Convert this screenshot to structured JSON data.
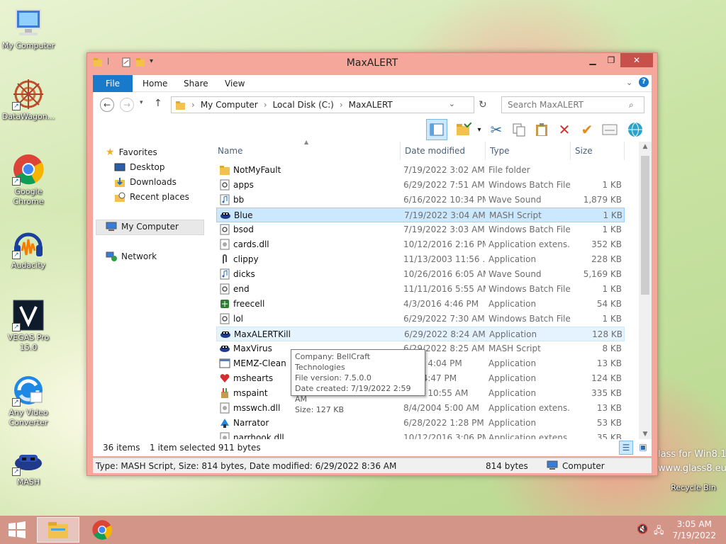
{
  "desktop": {
    "icons": [
      {
        "label": "My Computer",
        "icon": "computer-icon"
      },
      {
        "label": "DataWagon...",
        "icon": "datawagon-icon"
      },
      {
        "label": "Google Chrome",
        "icon": "chrome-icon"
      },
      {
        "label": "Audacity",
        "icon": "audacity-icon"
      },
      {
        "label": "VEGAS Pro 15.0",
        "icon": "vegas-icon"
      },
      {
        "label": "Any Video Converter",
        "icon": "video-converter-icon"
      },
      {
        "label": "MASH",
        "icon": "mash-icon"
      }
    ],
    "recycle_bin": "Recycle Bin",
    "watermark_line1": "lass for Win8.1",
    "watermark_line2": "www.glass8.eu"
  },
  "window": {
    "title": "MaxALERT",
    "ribbon_tabs": [
      "File",
      "Home",
      "Share",
      "View"
    ],
    "breadcrumbs": [
      "My Computer",
      "Local Disk (C:)",
      "MaxALERT"
    ],
    "search_placeholder": "Search MaxALERT",
    "nav": {
      "favorites": "Favorites",
      "desktop": "Desktop",
      "downloads": "Downloads",
      "recent": "Recent places",
      "computer": "My Computer",
      "network": "Network"
    },
    "columns": {
      "name": "Name",
      "date": "Date modified",
      "type": "Type",
      "size": "Size"
    },
    "files": [
      {
        "name": "NotMyFault",
        "date": "7/19/2022 3:02 AM",
        "type": "File folder",
        "size": "",
        "icon": "folder-icon"
      },
      {
        "name": "apps",
        "date": "6/29/2022 7:51 AM",
        "type": "Windows Batch File",
        "size": "1 KB",
        "icon": "batch-file-icon"
      },
      {
        "name": "bb",
        "date": "6/16/2022 10:34 PM",
        "type": "Wave Sound",
        "size": "1,879 KB",
        "icon": "wave-sound-icon"
      },
      {
        "name": "Blue",
        "date": "7/19/2022 3:04 AM",
        "type": "MASH Script",
        "size": "1 KB",
        "icon": "mash-script-icon"
      },
      {
        "name": "bsod",
        "date": "7/19/2022 3:03 AM",
        "type": "Windows Batch File",
        "size": "1 KB",
        "icon": "batch-file-icon"
      },
      {
        "name": "cards.dll",
        "date": "10/12/2016 2:16 PM",
        "type": "Application extens...",
        "size": "352 KB",
        "icon": "dll-icon"
      },
      {
        "name": "clippy",
        "date": "11/13/2003 11:56 ...",
        "type": "Application",
        "size": "228 KB",
        "icon": "clippy-icon"
      },
      {
        "name": "dicks",
        "date": "10/26/2016 6:05 AM",
        "type": "Wave Sound",
        "size": "5,169 KB",
        "icon": "wave-sound-icon"
      },
      {
        "name": "end",
        "date": "11/11/2016 5:55 AM",
        "type": "Windows Batch File",
        "size": "1 KB",
        "icon": "batch-file-icon"
      },
      {
        "name": "freecell",
        "date": "4/3/2016 4:46 PM",
        "type": "Application",
        "size": "54 KB",
        "icon": "freecell-icon"
      },
      {
        "name": "lol",
        "date": "6/29/2022 7:30 AM",
        "type": "Windows Batch File",
        "size": "1 KB",
        "icon": "batch-file-icon"
      },
      {
        "name": "MaxALERTKill",
        "date": "6/29/2022 8:24 AM",
        "type": "Application",
        "size": "128 KB",
        "icon": "mash-app-icon"
      },
      {
        "name": "MaxVirus",
        "date": "6/29/2022 8:25 AM",
        "type": "MASH Script",
        "size": "8 KB",
        "icon": "mash-script-icon"
      },
      {
        "name": "MEMZ-Clean",
        "date": "2016 4:04 PM",
        "type": "Application",
        "size": "13 KB",
        "icon": "application-icon"
      },
      {
        "name": "mshearts",
        "date": "016 4:47 PM",
        "type": "Application",
        "size": "124 KB",
        "icon": "hearts-icon"
      },
      {
        "name": "mspaint",
        "date": "2017 10:55 AM",
        "type": "Application",
        "size": "335 KB",
        "icon": "paint-icon"
      },
      {
        "name": "msswch.dll",
        "date": "8/4/2004 5:00 AM",
        "type": "Application extens...",
        "size": "13 KB",
        "icon": "dll-icon"
      },
      {
        "name": "Narrator",
        "date": "6/28/2022 1:28 PM",
        "type": "Application",
        "size": "53 KB",
        "icon": "narrator-icon"
      },
      {
        "name": "narrhook.dll",
        "date": "10/12/2016 3:06 PM",
        "type": "Application extens...",
        "size": "35 KB",
        "icon": "dll-icon"
      }
    ],
    "tooltip": {
      "company": "Company: BellCraft Technologies",
      "version": "File version: 7.5.0.0",
      "created": "Date created: 7/19/2022 2:59 AM",
      "size": "Size: 127 KB"
    },
    "status": {
      "items": "36 items",
      "selected": "1 item selected  911 bytes"
    },
    "details": {
      "text": "Type: MASH Script, Size: 814 bytes, Date modified: 6/29/2022 8:36 AM",
      "size": "814 bytes",
      "location": "Computer"
    }
  },
  "taskbar": {
    "time": "3:05 AM",
    "date": "7/19/2022"
  }
}
